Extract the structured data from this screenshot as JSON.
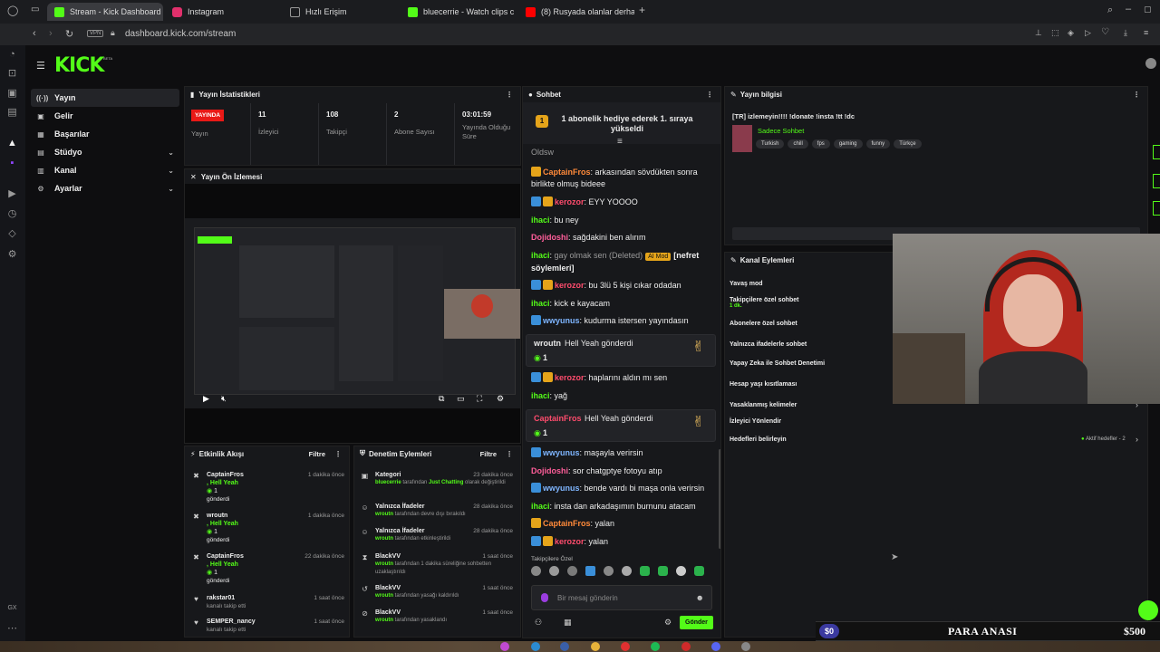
{
  "browser": {
    "tabs": [
      {
        "label": "Stream - Kick Dashboard",
        "color": "#53fc18"
      },
      {
        "label": "Instagram",
        "color": "#e1306c"
      },
      {
        "label": "Hızlı Erişim",
        "color": "#888888"
      },
      {
        "label": "bluecerrie - Watch clips c",
        "color": "#53fc18"
      },
      {
        "label": "(8) Rusyada olanlar derha",
        "color": "#ff0000"
      }
    ],
    "url": "dashboard.kick.com/stream",
    "vpn": "VPN"
  },
  "kick": {
    "logo": "KICK",
    "beta": "BETA"
  },
  "sidebar": {
    "items": [
      {
        "label": "Yayın",
        "icon": "broadcast-icon"
      },
      {
        "label": "Gelir",
        "icon": "wallet-icon"
      },
      {
        "label": "Başarılar",
        "icon": "trophy-icon"
      },
      {
        "label": "Stüdyo",
        "icon": "studio-icon"
      },
      {
        "label": "Kanal",
        "icon": "channel-icon"
      },
      {
        "label": "Ayarlar",
        "icon": "settings-icon"
      }
    ]
  },
  "stats": {
    "title": "Yayın İstatistikleri",
    "live": "YAYINDA",
    "live_label": "Yayın",
    "viewers": "11",
    "viewers_label": "İzleyici",
    "followers": "108",
    "followers_label": "Takipçi",
    "subs": "2",
    "subs_label": "Abone Sayısı",
    "uptime": "03:01:59",
    "uptime_label": "Yayında Olduğu Süre"
  },
  "preview": {
    "title": "Yayın Ön İzlemesi"
  },
  "chat": {
    "title": "Sohbet",
    "pinned": "1 abonelik hediye ederek 1. sıraya yükseldi",
    "top_cut": "Oldsw",
    "messages": [
      {
        "user": "CaptainFros",
        "text": "arkasından sövdükten sonra birlikte olmuş bideee",
        "cls": "u-orange"
      },
      {
        "user": "kerozor",
        "text": "EYY YOOOO",
        "cls": "u-red"
      },
      {
        "user": "ihaci",
        "text": "bu ney",
        "cls": "u-green"
      },
      {
        "user": "Dojidoshi",
        "text": "sağdakini ben alırım",
        "cls": "u-pink"
      },
      {
        "user": "ihaci",
        "text": "gay olmak sen (Deleted)",
        "mod": "AI Mod",
        "extra": "[nefret söylemleri]",
        "cls": "u-green"
      },
      {
        "user": "kerozor",
        "text": "bu 3lü 5 kişi cıkar odadan",
        "cls": "u-red"
      },
      {
        "user": "ihaci",
        "text": "kick e kayacam",
        "cls": "u-green"
      },
      {
        "user": "wwyunus",
        "text": "kudurma istersen yayındasın",
        "cls": "u-blue"
      },
      {
        "user": "kerozor",
        "text": "haplarını aldın mı sen",
        "cls": "u-red"
      },
      {
        "user": "ihaci",
        "text": "yağ",
        "cls": "u-green"
      },
      {
        "user": "wwyunus",
        "text": "maşayla verirsin",
        "cls": "u-blue"
      },
      {
        "user": "Dojidoshi",
        "text": "sor chatgptye fotoyu atıp",
        "cls": "u-pink"
      },
      {
        "user": "wwyunus",
        "text": "bende vardı bi maşa onla verirsin",
        "cls": "u-blue"
      },
      {
        "user": "ihaci",
        "text": "insta dan arkadaşımın burnunu atacam",
        "cls": "u-green"
      },
      {
        "user": "CaptainFros",
        "text": "yalan",
        "cls": "u-orange"
      },
      {
        "user": "kerozor",
        "text": "yalan",
        "cls": "u-red"
      }
    ],
    "gifts": [
      {
        "user": "wroutn",
        "text": "Hell Yeah gönderdi",
        "count": "1"
      },
      {
        "user": "CaptainFros",
        "text": "Hell Yeah gönderdi",
        "count": "1"
      }
    ],
    "followers_only": "Takipçilere Özel",
    "input_placeholder": "Bir mesaj gönderin",
    "send": "Gönder"
  },
  "activity": {
    "title": "Etkinlik Akışı",
    "filter": "Filtre",
    "items": [
      {
        "user": "CaptainFros",
        "gift": ", Hell Yeah",
        "count": "1",
        "action": "gönderdi",
        "time": "1 dakika önce"
      },
      {
        "user": "wroutn",
        "gift": ", Hell Yeah",
        "count": "1",
        "action": "gönderdi",
        "time": "1 dakika önce"
      },
      {
        "user": "CaptainFros",
        "gift": ", Hell Yeah",
        "count": "1",
        "action": "gönderdi",
        "time": "22 dakika önce"
      },
      {
        "user": "rakstar01",
        "action": "kanalı takip etti",
        "time": "1 saat önce"
      },
      {
        "user": "SEMPER_nancy",
        "action": "kanalı takip etti",
        "time": "1 saat önce"
      }
    ]
  },
  "moderation": {
    "title": "Denetim Eylemleri",
    "filter": "Filtre",
    "items": [
      {
        "title": "Kategori",
        "actor": "bluecerrie",
        "pre": " tarafından ",
        "target": "Just Chatting",
        "post": " olarak değiştirildi",
        "time": "23 dakika önce"
      },
      {
        "title": "Yalnızca İfadeler",
        "actor": "wroutn",
        "pre": " tarafından devre dışı bırakıldı",
        "target": "",
        "post": "",
        "time": "28 dakika önce"
      },
      {
        "title": "Yalnızca İfadeler",
        "actor": "wroutn",
        "pre": " tarafından etkinleştirildi",
        "target": "",
        "post": "",
        "time": "28 dakika önce"
      },
      {
        "title": "BlackVV",
        "actor": "wroutn",
        "pre": " tarafından 1 dakika süreliğine sohbetten uzaklaştırıldı",
        "target": "",
        "post": "",
        "time": "1 saat önce"
      },
      {
        "title": "BlackVV",
        "actor": "wroutn",
        "pre": " tarafından yasağı kaldırıldı",
        "target": "",
        "post": "",
        "time": "1 saat önce"
      },
      {
        "title": "BlackVV",
        "actor": "wroutn",
        "pre": " tarafından yasaklandı",
        "target": "",
        "post": "",
        "time": "1 saat önce"
      }
    ]
  },
  "info": {
    "title": "Yayın bilgisi",
    "stream_title": "[TR] izlemeyin!!!! !donate !insta !tt !dc",
    "category": "Sadece Sohbet",
    "tags": [
      "Turkish",
      "chill",
      "fps",
      "gaming",
      "funny",
      "Türkçe"
    ]
  },
  "channel_actions": {
    "title": "Kanal Eylemleri",
    "items": [
      {
        "label": "Yavaş mod"
      },
      {
        "label": "Takipçilere özel sohbet",
        "sub": "1 dk."
      },
      {
        "label": "Abonelere özel sohbet"
      },
      {
        "label": "Yalnızca ifadelerle sohbet"
      },
      {
        "label": "Yapay Zeka ile Sohbet Denetimi"
      },
      {
        "label": "Hesap yaşı kısıtlaması"
      },
      {
        "label": "Yasaklanmış kelimeler"
      },
      {
        "label": "İzleyici Yönlendir"
      },
      {
        "label": "Hedefleri belirleyin"
      }
    ],
    "active_goals": "Aktif hedefler - 2"
  },
  "goal_bar": {
    "current": "$0",
    "label": "PARA ANASI",
    "target": "$500"
  },
  "colors": {
    "accent": "#53fc18",
    "live": "#e91916",
    "panel": "#17181b"
  }
}
